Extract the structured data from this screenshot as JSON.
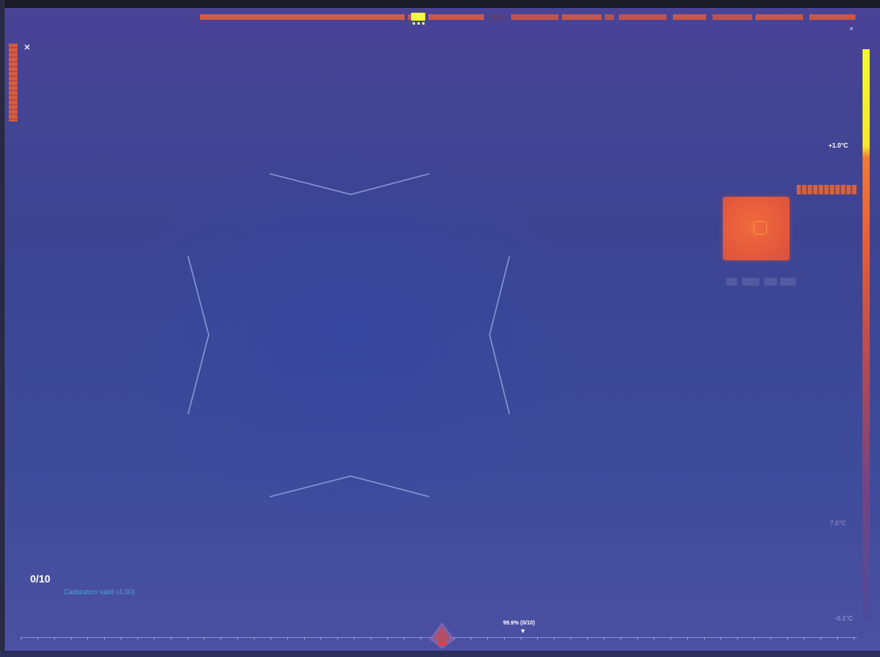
{
  "colors": {
    "background": "#3d4696",
    "scale_top": "#f4f92e",
    "scale_mid": "#e45d38",
    "hot_spot": "#e85b3b",
    "calibration_text": "#46a0e0",
    "marker": "#f1ff3c"
  },
  "header": {
    "close_icon": "close-icon"
  },
  "color_scale": {
    "top_label": "",
    "main_label": "+1.0°C",
    "mid_label": "7.0°C",
    "bottom_label": "-0.1°C"
  },
  "status": {
    "counter": "0/10",
    "calibration": "Calibration valid (4.00)"
  },
  "timeline": {
    "position_label": "99.9% (0/10)"
  }
}
